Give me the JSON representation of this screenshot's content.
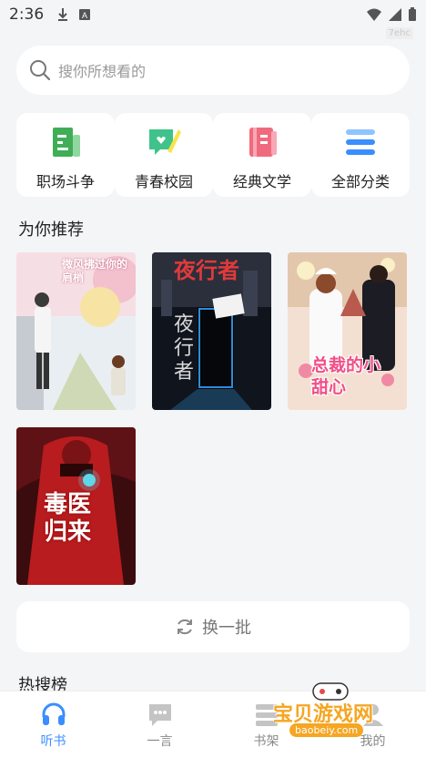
{
  "status_bar": {
    "time": "2:36",
    "tag": "7ehc"
  },
  "search": {
    "placeholder": "搜你所想看的"
  },
  "categories": [
    {
      "label": "职场斗争",
      "icon": "workplace-book-icon",
      "color": "#3fae56"
    },
    {
      "label": "青春校园",
      "icon": "youth-campus-icon",
      "color": "#3fc38a"
    },
    {
      "label": "经典文学",
      "icon": "classic-literature-icon",
      "color": "#f06a7e"
    },
    {
      "label": "全部分类",
      "icon": "all-categories-icon",
      "color": "#3a8eff"
    }
  ],
  "recommend": {
    "title": "为你推荐",
    "books": [
      {
        "cover_text": "微风拂过你的肩梢"
      },
      {
        "cover_text": "夜行者"
      },
      {
        "cover_text": "总裁的小甜心"
      },
      {
        "cover_text": "毒医归来"
      }
    ]
  },
  "refresh": {
    "label": "换一批"
  },
  "hot": {
    "title": "热搜榜"
  },
  "tabs": [
    {
      "label": "听书",
      "icon": "headphones-icon",
      "active": true
    },
    {
      "label": "一言",
      "icon": "chat-bubble-icon",
      "active": false
    },
    {
      "label": "书架",
      "icon": "bookshelf-icon",
      "active": false
    },
    {
      "label": "我的",
      "icon": "profile-icon",
      "active": false
    }
  ],
  "watermark": {
    "title": "宝贝游戏网",
    "url": "baobeiy.com"
  },
  "colors": {
    "accent": "#3a8eff",
    "background": "#f4f5f7",
    "card": "#ffffff"
  }
}
